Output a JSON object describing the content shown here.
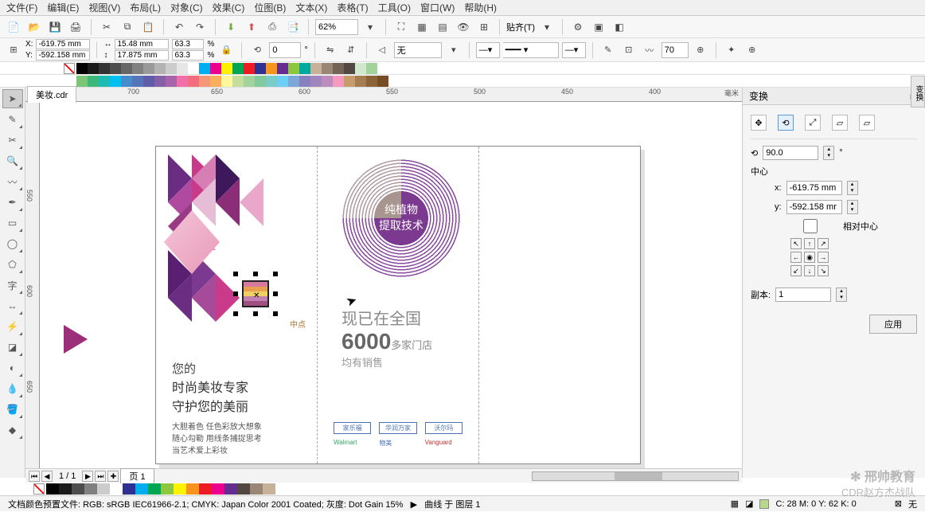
{
  "menu": [
    "文件(F)",
    "编辑(E)",
    "视图(V)",
    "布局(L)",
    "对象(C)",
    "效果(C)",
    "位图(B)",
    "文本(X)",
    "表格(T)",
    "工具(O)",
    "窗口(W)",
    "帮助(H)"
  ],
  "toolbar1": {
    "zoom_value": "62%",
    "align_label": "贴齐(T)"
  },
  "propbar": {
    "x_label": "X:",
    "x_value": "-619.75 mm",
    "y_label": "Y:",
    "y_value": "-592.158 mm",
    "w_value": "15.48 mm",
    "h_value": "17.875 mm",
    "scale_x": "63.3",
    "scale_y": "63.3",
    "rot": "0",
    "fill": "无",
    "outline_w": "70"
  },
  "file_tab": "美妆.cdr",
  "ruler_h": [
    "700",
    "650",
    "600",
    "550",
    "500",
    "450",
    "400"
  ],
  "ruler_h_unit": "毫米",
  "ruler_v": [
    "550",
    "600",
    "650"
  ],
  "design": {
    "left": {
      "heading1": "您的",
      "heading2": "时尚美妆专家",
      "heading3": "守护您的美丽",
      "lines": [
        "大胆着色 任色彩放大想象",
        "随心勾勒 用线条捕捉思考",
        "当艺术爱上彩妆"
      ]
    },
    "mid": {
      "circle_top": "纯植物",
      "circle_bot": "提取技术",
      "line1": "现已在全国",
      "big_num": "6000",
      "line2_suffix": "多家门店",
      "line3": "均有销售",
      "brands": [
        "家乐福",
        "华润万家",
        "沃尔玛",
        "Walmart",
        "物美",
        "Vanguard"
      ]
    },
    "sel_label": "中点"
  },
  "docker": {
    "title": "变换",
    "angle": "90.0",
    "center_label": "中心",
    "x_label": "x:",
    "x_value": "-619.75 mm",
    "y_label": "y:",
    "y_value": "-592.158 mr",
    "relative": "相对中心",
    "copies_label": "副本:",
    "copies_value": "1",
    "apply": "应用"
  },
  "sidebar_tab": "变换",
  "tabbar": {
    "page_indicator": "1 / 1",
    "page_tab": "页 1"
  },
  "status": {
    "left": "文档颜色预置文件: RGB: sRGB IEC61966-2.1; CMYK: Japan Color 2001 Coated; 灰度: Dot Gain 15%",
    "mid": "曲线 于 图层 1",
    "right_cmyk": "C: 28 M: 0 Y: 62 K: 0",
    "fill_label": "无"
  },
  "watermark": {
    "line1": "邢帅教育",
    "line2": "CDR赵方杰战队"
  },
  "palette_colors": [
    "#000000",
    "#1a1a1a",
    "#333333",
    "#4d4d4d",
    "#666666",
    "#808080",
    "#999999",
    "#b3b3b3",
    "#cccccc",
    "#e6e6e6",
    "#ffffff",
    "#00aeef",
    "#ec008c",
    "#fff200",
    "#00a651",
    "#ed1c24",
    "#2e3192",
    "#f7941d",
    "#662d91",
    "#8dc63f",
    "#00a99d",
    "#c7b299",
    "#998675",
    "#736357",
    "#534741",
    "#d0e8cc",
    "#a3d39c",
    "#7cc576",
    "#3cb878",
    "#1cbbb4",
    "#00bff3",
    "#448ccb",
    "#5674b9",
    "#605ca8",
    "#8560a8",
    "#a864a8",
    "#f06eaa",
    "#f26d7d",
    "#f69679",
    "#fbaf5d",
    "#fff799",
    "#c4df9b",
    "#a3d39c",
    "#82ca9c",
    "#7accc8",
    "#6dcff6",
    "#7da7d9",
    "#8781bd",
    "#a186be",
    "#bd8cbf",
    "#f49ac1",
    "#c69c6d",
    "#a67c52",
    "#8c6239",
    "#754c24"
  ],
  "bottom_palette": [
    "#000000",
    "#1a1a1a",
    "#4d4d4d",
    "#808080",
    "#cccccc",
    "#ffffff",
    "#2e3192",
    "#00aeef",
    "#00a651",
    "#8dc63f",
    "#fff200",
    "#f7941d",
    "#ed1c24",
    "#ec008c",
    "#662d91",
    "#534741",
    "#998675",
    "#c7b299"
  ]
}
